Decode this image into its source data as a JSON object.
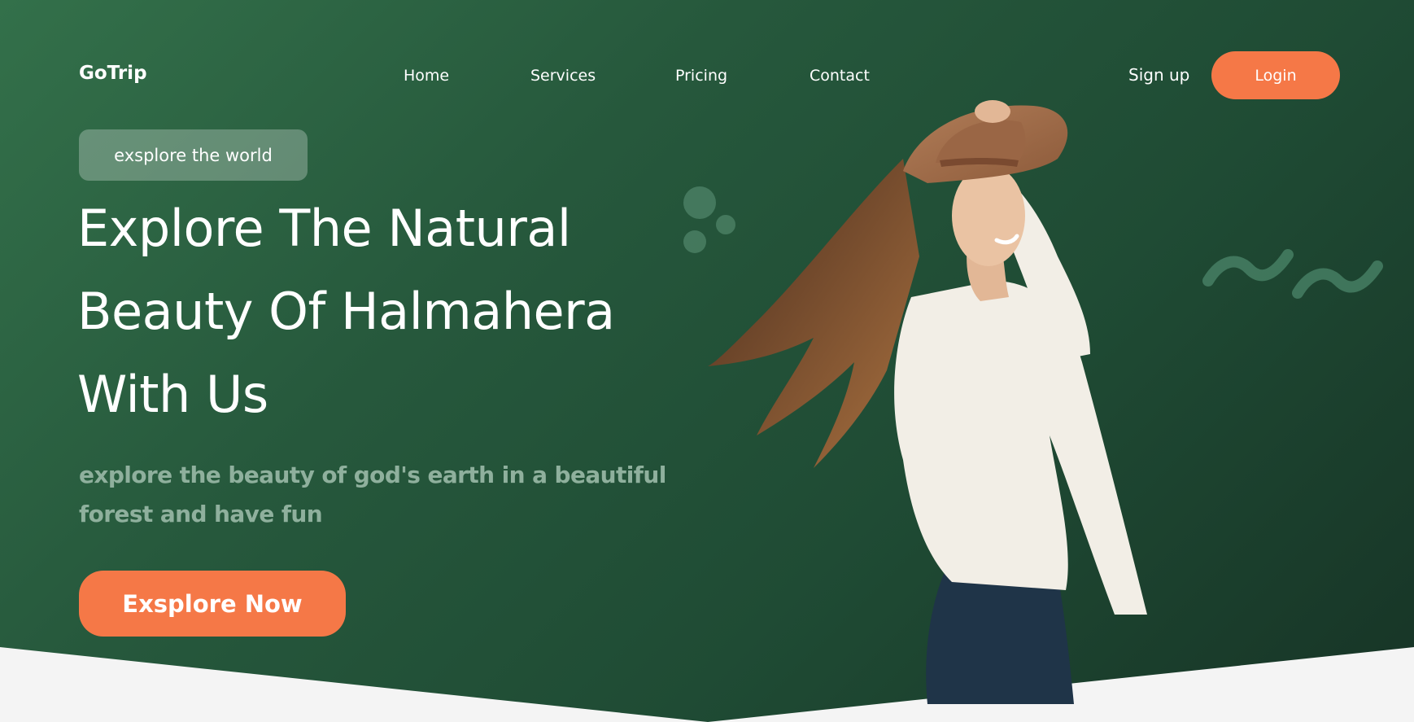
{
  "brand": {
    "logo": "GoTrip"
  },
  "nav": {
    "links": [
      "Home",
      "Services",
      "Pricing",
      "Contact"
    ],
    "signup": "Sign up",
    "login": "Login"
  },
  "hero": {
    "tag": "exsplore the world",
    "headline_lines": [
      "Explore The Natural",
      "Beauty Of Halmahera",
      "With Us"
    ],
    "subtitle": "explore the beauty of god's earth in a beautiful forest and have fun",
    "cta": "Exsplore Now",
    "image": "woman-in-hat-photo"
  },
  "colors": {
    "accent": "#f57847",
    "hero_bg_start": "#33704a",
    "hero_bg_end": "#173426",
    "subtitle": "#8fb09d",
    "page_bg": "#f4f4f4"
  }
}
